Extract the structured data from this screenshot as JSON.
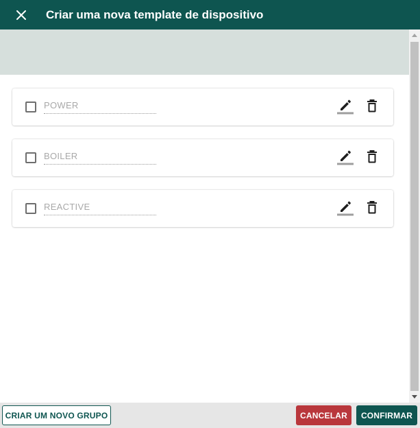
{
  "dialog": {
    "title": "Criar uma nova template de dispositivo",
    "close_icon": "close-icon"
  },
  "groups": [
    {
      "placeholder": "POWER",
      "checked": false
    },
    {
      "placeholder": "BOILER",
      "checked": false
    },
    {
      "placeholder": "REACTIVE",
      "checked": false
    }
  ],
  "icons": {
    "edit": "pencil-icon",
    "delete": "trash-icon"
  },
  "footer": {
    "new_group_label": "CRIAR UM NOVO GRUPO",
    "cancel_label": "CANCELAR",
    "confirm_label": "CONFIRMAR"
  },
  "colors": {
    "primary": "#0e5550",
    "danger": "#b9373c",
    "band": "#d6dfdc",
    "footer": "#e6e6e6"
  }
}
